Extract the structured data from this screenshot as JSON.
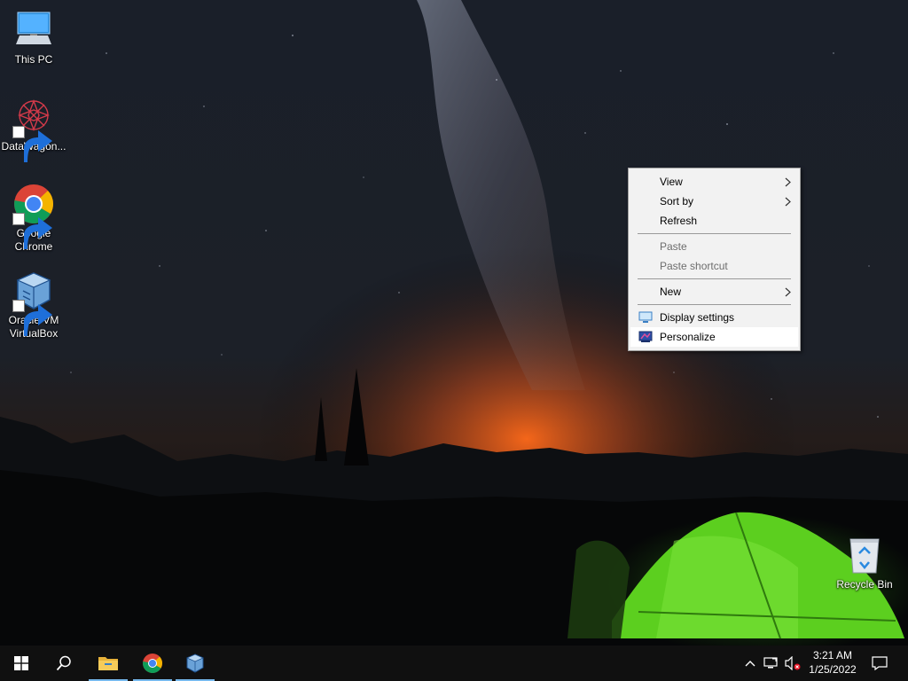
{
  "desktop": {
    "icons": [
      {
        "label": "This PC",
        "icon": "computer-icon"
      },
      {
        "label": "DataWagon...",
        "icon": "datawagon-icon",
        "shortcut": true
      },
      {
        "label": "Google Chrome",
        "icon": "chrome-icon",
        "shortcut": true
      },
      {
        "label": "Oracle VM VirtualBox",
        "icon": "virtualbox-icon",
        "shortcut": true
      },
      {
        "label": "Recycle Bin",
        "icon": "recycle-bin-icon"
      }
    ]
  },
  "context_menu": {
    "items": [
      {
        "label": "View",
        "submenu": true,
        "enabled": true
      },
      {
        "label": "Sort by",
        "submenu": true,
        "enabled": true
      },
      {
        "label": "Refresh",
        "enabled": true
      },
      {
        "label": "Paste",
        "enabled": false
      },
      {
        "label": "Paste shortcut",
        "enabled": false
      },
      {
        "label": "New",
        "submenu": true,
        "enabled": true
      },
      {
        "label": "Display settings",
        "icon": "display-icon",
        "enabled": true
      },
      {
        "label": "Personalize",
        "icon": "personalize-icon",
        "enabled": true,
        "highlighted": true
      }
    ]
  },
  "taskbar": {
    "pinned": [
      {
        "name": "start",
        "icon": "windows-logo-icon"
      },
      {
        "name": "search",
        "icon": "search-icon"
      },
      {
        "name": "file-explorer",
        "icon": "folder-icon",
        "running": true
      },
      {
        "name": "chrome",
        "icon": "chrome-icon",
        "running": true
      },
      {
        "name": "virtualbox",
        "icon": "virtualbox-icon",
        "running": true
      }
    ],
    "tray": {
      "icons": [
        "chevron-up-icon",
        "network-disconnected-icon",
        "volume-muted-icon"
      ],
      "time": "3:21 AM",
      "date": "1/25/2022",
      "notification_icon": "action-center-icon"
    }
  },
  "colors": {
    "taskbar": "#101010",
    "menu_bg": "#f2f2f2",
    "accent_running": "#76b9ed"
  }
}
